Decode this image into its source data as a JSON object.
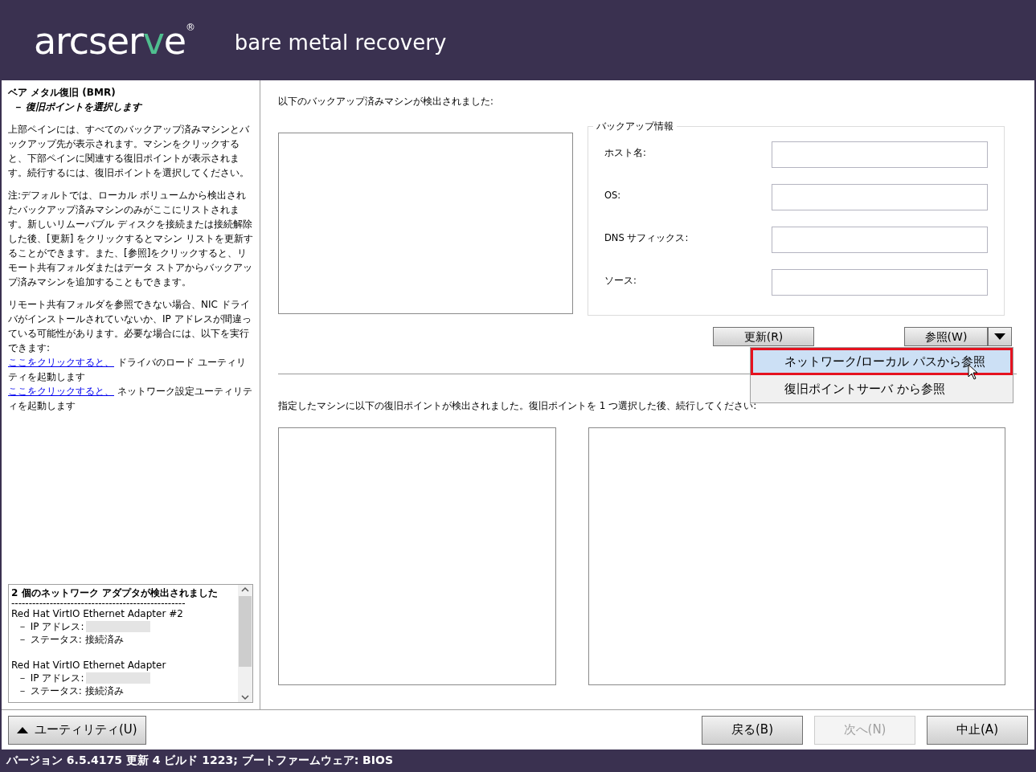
{
  "header": {
    "logo": {
      "before": "arcser",
      "accent": "v",
      "after": "e",
      "mark": "®"
    },
    "product": "bare metal recovery"
  },
  "sidebar": {
    "title": "ベア メタル復旧 (BMR)",
    "subtitle": "－ 復旧ポイントを選択します",
    "paragraphs": [
      {
        "kind": "text",
        "text": "上部ペインには、すべてのバックアップ済みマシンとバックアップ先が表示されます。マシンをクリックすると、下部ペインに関連する復旧ポイントが表示されます。続行するには、復旧ポイントを選択してください。"
      },
      {
        "kind": "text",
        "text": "注:デフォルトでは、ローカル ボリュームから検出されたバックアップ済みマシンのみがここにリストされます。新しいリムーバブル ディスクを接続または接続解除した後、[更新] をクリックするとマシン リストを更新することができます。また、[参照]をクリックすると、リモート共有フォルダまたはデータ ストアからバックアップ済みマシンを追加することもできます。"
      },
      {
        "kind": "text",
        "text": "リモート共有フォルダを参照できない場合、NIC ドライバがインストールされていないか、IP アドレスが間違っている可能性があります。必要な場合には、以下を実行できます:"
      },
      {
        "kind": "link",
        "link": "ここをクリックすると、",
        "text": " ドライバのロード ユーティリティを起動します"
      },
      {
        "kind": "link",
        "link": "ここをクリックすると、",
        "text": " ネットワーク設定ユーティリティを起動します"
      }
    ],
    "network": {
      "title": "2 個のネットワーク アダプタが検出されました",
      "rule": "--------------------------------------------------",
      "adapters": [
        {
          "name": "Red Hat VirtIO Ethernet Adapter #2",
          "ip_label": "－ IP アドレス:",
          "status": "－ ステータス: 接続済み"
        },
        {
          "name": "Red Hat VirtIO Ethernet Adapter",
          "ip_label": "－ IP アドレス:",
          "status": "－ ステータス: 接続済み"
        }
      ]
    },
    "utility_button": "ユーティリティ(U)"
  },
  "main": {
    "machines_label": "以下のバックアップ済みマシンが検出されました:",
    "backup_info": {
      "legend": "バックアップ情報",
      "fields": [
        {
          "label": "ホスト名:"
        },
        {
          "label": "OS:"
        },
        {
          "label": "DNS サフィックス:"
        },
        {
          "label": "ソース:"
        }
      ]
    },
    "refresh_button": "更新(R)",
    "browse_button": "参照(W)",
    "browse_menu": [
      {
        "label": "ネットワーク/ローカル パスから参照",
        "selected": true
      },
      {
        "label": "復旧ポイントサーバ から参照",
        "selected": false
      }
    ],
    "points_label": "指定したマシンに以下の復旧ポイントが検出されました。復旧ポイントを 1 つ選択した後、続行してください:"
  },
  "footer": {
    "buttons": [
      {
        "label": "戻る(B)",
        "disabled": false
      },
      {
        "label": "次へ(N)",
        "disabled": true
      },
      {
        "label": "中止(A)",
        "disabled": false
      }
    ]
  },
  "status_bar": "バージョン 6.5.4175 更新 4 ビルド 1223; ブートファームウェア: BIOS"
}
